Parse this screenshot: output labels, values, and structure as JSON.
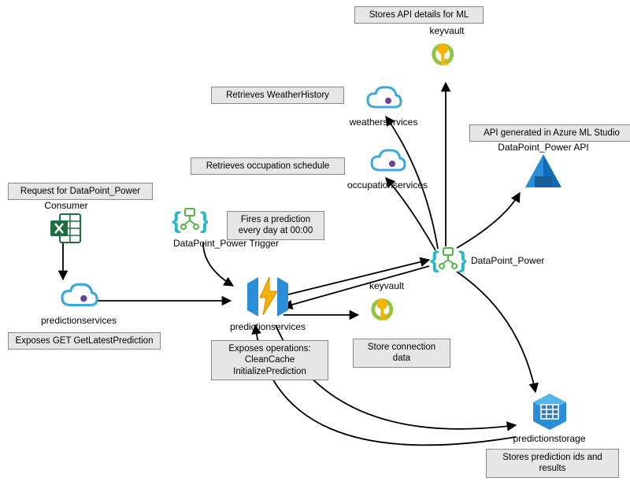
{
  "labels": {
    "stores_api_ml": "Stores API details for ML",
    "retrieves_weather": "Retrieves WeatherHistory",
    "retrieves_occupation": "Retrieves occupation schedule",
    "api_generated": "API generated in Azure ML Studio",
    "request_dp_power": "Request for DataPoint_Power",
    "fires_prediction": "Fires a prediction every day at 00:00",
    "exposes_get": "Exposes GET GetLatestPrediction",
    "exposes_ops_title": "Exposes operations:",
    "exposes_ops_1": "CleanCache",
    "exposes_ops_2": "InitializePrediction",
    "store_conn_data": "Store connection data",
    "stores_pred_ids": "Stores prediction ids and results"
  },
  "nodes": {
    "consumer": "Consumer",
    "predictionservices_left": "predictionservices",
    "datapoint_trigger": "DataPoint_Power Trigger",
    "predictionservices_center": "predictionservices",
    "weatherservices": "weatherservices",
    "occupationservices": "occupationservices",
    "keyvault_top": "keyvault",
    "keyvault_mid": "keyvault",
    "datapoint_power": "DataPoint_Power",
    "datapoint_api": "DataPoint_Power API",
    "predictionstorage": "predictionstorage"
  }
}
